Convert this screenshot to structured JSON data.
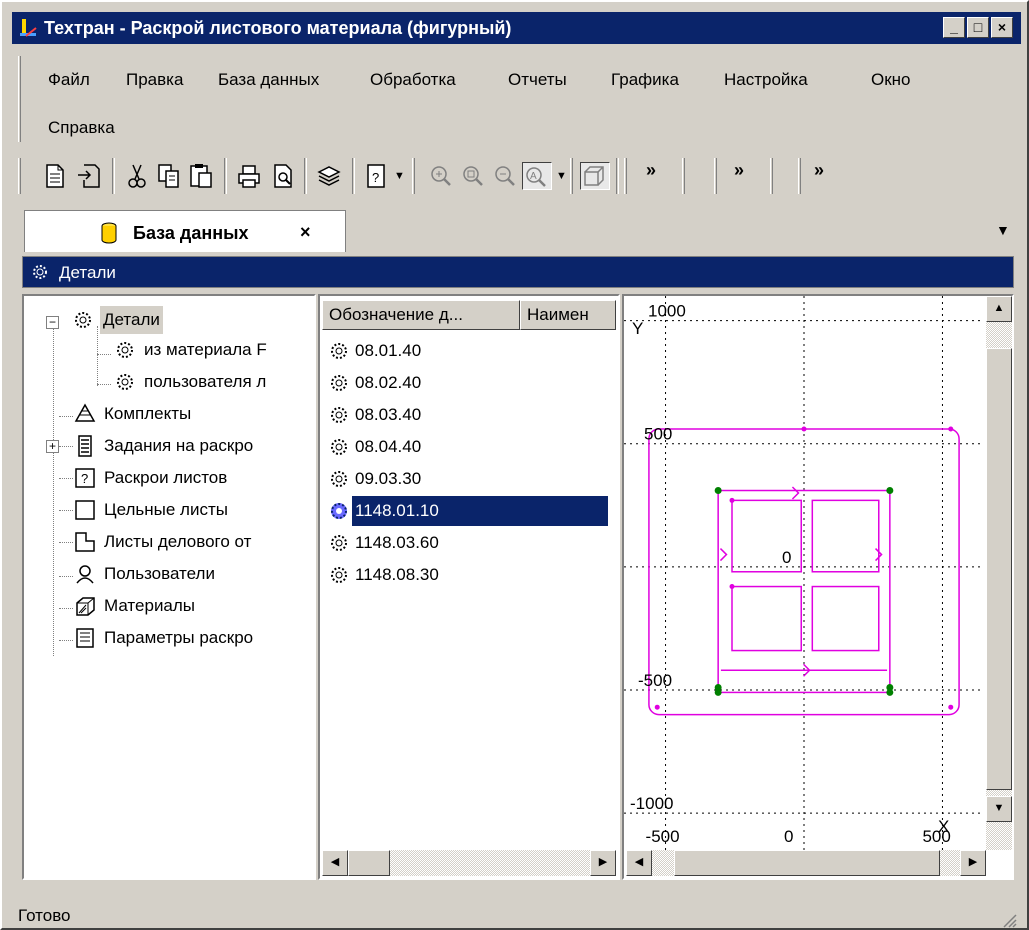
{
  "window": {
    "title": "Техтран - Раскрой листового материала (фигурный)",
    "controls": [
      "_",
      "□",
      "×"
    ]
  },
  "menu": {
    "items": [
      "Файл",
      "Правка",
      "База данных",
      "Обработка",
      "Отчеты",
      "Графика",
      "Настройка",
      "Окно",
      "Справка"
    ]
  },
  "toolbar": {
    "icons": [
      "new-document-icon",
      "import-icon",
      "cut-icon",
      "copy-icon",
      "paste-icon",
      "print-icon",
      "print-preview-icon",
      "layers-icon",
      "help-icon",
      "zoom-in-icon",
      "zoom-window-icon",
      "zoom-out-icon",
      "zoom-all-icon",
      "3d-view-icon"
    ],
    "chevron": "»"
  },
  "tab": {
    "label": "База данных",
    "close": "×"
  },
  "panel": {
    "header": "Детали"
  },
  "tree": {
    "items": [
      {
        "label": "Детали",
        "icon": "gear-icon"
      },
      {
        "label": "из материала F",
        "icon": "gear-icon"
      },
      {
        "label": "пользователя л",
        "icon": "gear-icon"
      },
      {
        "label": "Комплекты",
        "icon": "kit-icon"
      },
      {
        "label": "Задания на раскро",
        "icon": "task-icon"
      },
      {
        "label": "Раскрои листов",
        "icon": "nesting-icon"
      },
      {
        "label": "Цельные листы",
        "icon": "sheet-icon"
      },
      {
        "label": "Листы делового от",
        "icon": "remnant-icon"
      },
      {
        "label": "Пользователи",
        "icon": "users-icon"
      },
      {
        "label": "Материалы",
        "icon": "material-icon"
      },
      {
        "label": "Параметры раскро",
        "icon": "params-icon"
      }
    ]
  },
  "list": {
    "columns": [
      "Обозначение д...",
      "Наимен"
    ],
    "rows": [
      "08.01.40",
      "08.02.40",
      "08.03.40",
      "08.04.40",
      "09.03.30",
      "1148.01.10",
      "1148.03.60",
      "1148.08.30"
    ],
    "selected": "1148.01.10"
  },
  "chart_data": {
    "type": "scatter",
    "xlabel": "X",
    "ylabel": "Y",
    "x_ticks": [
      "-500",
      "0",
      "500"
    ],
    "y_ticks": [
      "1000",
      "500",
      "0",
      "-500",
      "-1000"
    ],
    "xlim": [
      -650,
      650
    ],
    "ylim": [
      -1150,
      1100
    ],
    "grid": true,
    "colors": {
      "part": "#e000e0",
      "grid": "#000000",
      "node": "#008000"
    }
  },
  "status": {
    "text": "Готово"
  }
}
